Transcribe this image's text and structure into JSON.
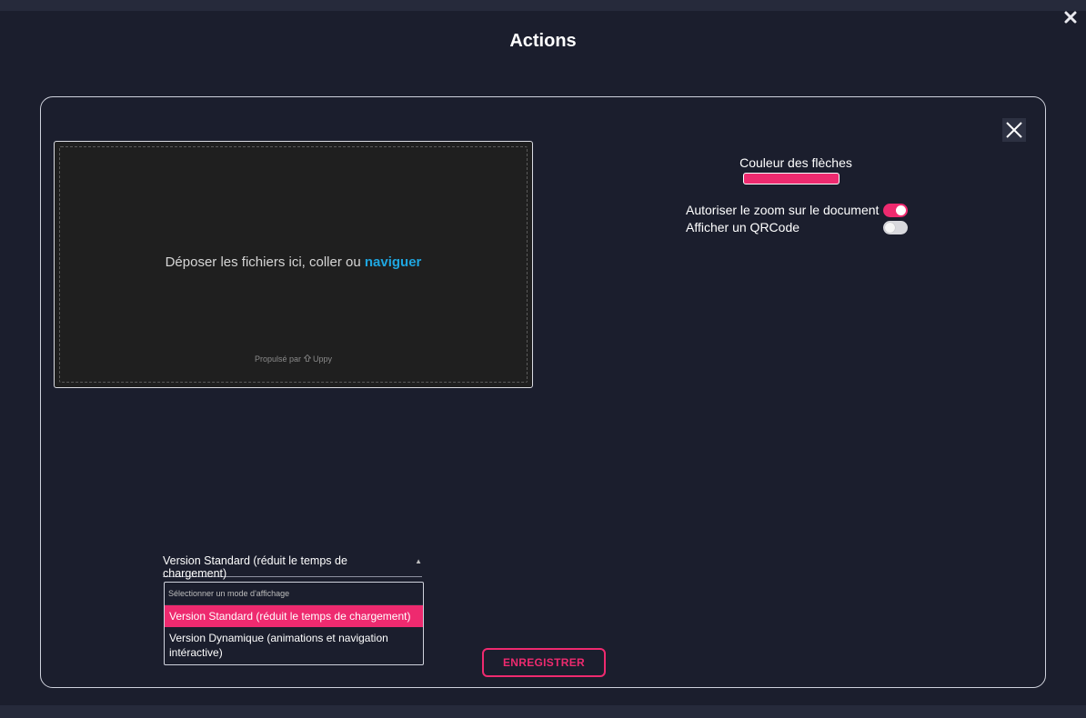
{
  "modal": {
    "title": "Actions"
  },
  "uploader": {
    "drop_text": "Déposer les fichiers ici, coller ou",
    "browse_label": "naviguer",
    "powered_by": "Propulsé par",
    "brand": "Uppy"
  },
  "settings": {
    "arrow_color_label": "Couleur des flèches",
    "arrow_color": "#ee2a6f",
    "toggles": [
      {
        "label": "Autoriser le zoom sur le document",
        "on": true
      },
      {
        "label": "Afficher un QRCode",
        "on": false
      }
    ]
  },
  "display_mode": {
    "selected": "Version Standard (réduit le temps de chargement)",
    "placeholder": "Sélectionner un mode d'affichage",
    "options": [
      "Version Standard (réduit le temps de chargement)",
      "Version Dynamique (animations et navigation intéractive)"
    ]
  },
  "actions": {
    "save_label": "ENREGISTRER"
  },
  "colors": {
    "accent": "#ee2a6f",
    "background": "#1b1e2d",
    "link": "#1fa6e0"
  }
}
